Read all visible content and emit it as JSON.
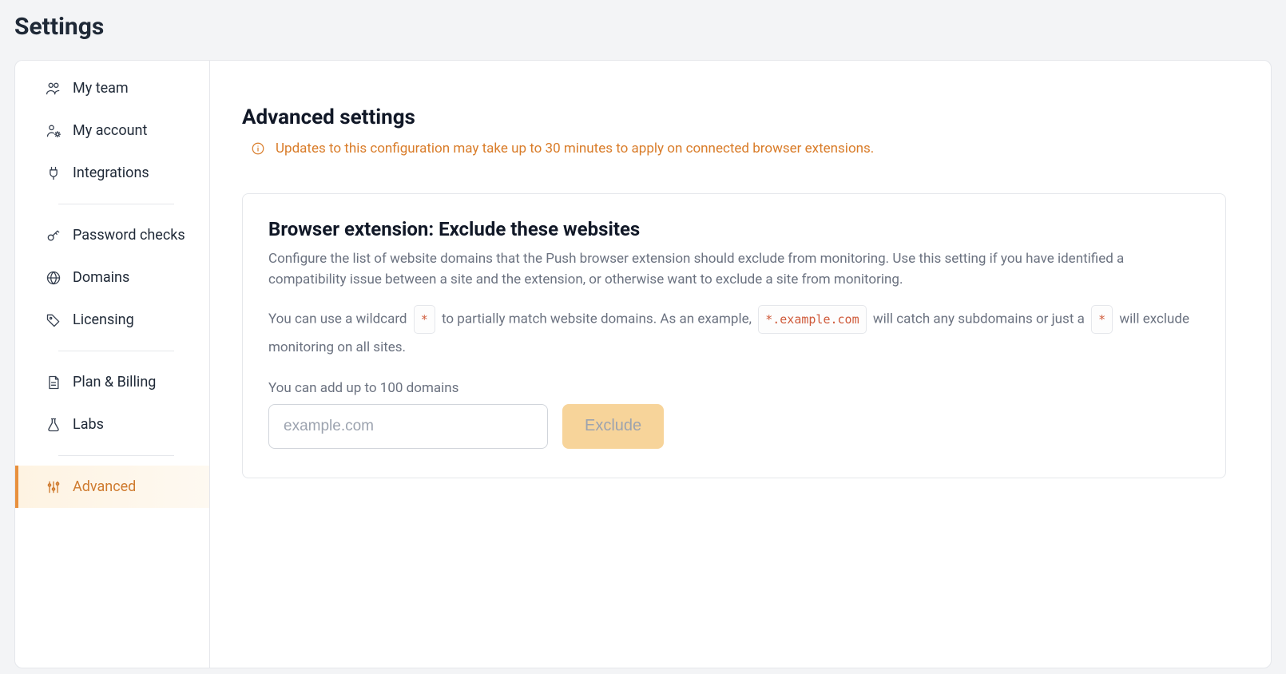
{
  "pageTitle": "Settings",
  "sidebar": {
    "items": [
      {
        "label": "My team"
      },
      {
        "label": "My account"
      },
      {
        "label": "Integrations"
      },
      {
        "label": "Password checks"
      },
      {
        "label": "Domains"
      },
      {
        "label": "Licensing"
      },
      {
        "label": "Plan & Billing"
      },
      {
        "label": "Labs"
      },
      {
        "label": "Advanced"
      }
    ]
  },
  "content": {
    "title": "Advanced settings",
    "warning": "Updates to this configuration may take up to 30 minutes to apply on connected browser extensions."
  },
  "card": {
    "title": "Browser extension: Exclude these websites",
    "description": "Configure the list of website domains that the Push browser extension should exclude from monitoring. Use this setting if you have identified a compatibility issue between a site and the extension, or otherwise want to exclude a site from monitoring.",
    "wildcard": {
      "pre": "You can use a wildcard ",
      "chip1": "*",
      "mid1": " to partially match website domains. As an example, ",
      "chip2": "*.example.com",
      "mid2": " will catch any subdomains or just a ",
      "chip3": "*",
      "post": " will exclude monitoring on all sites."
    },
    "limitLabel": "You can add up to 100 domains",
    "inputPlaceholder": "example.com",
    "buttonLabel": "Exclude"
  }
}
